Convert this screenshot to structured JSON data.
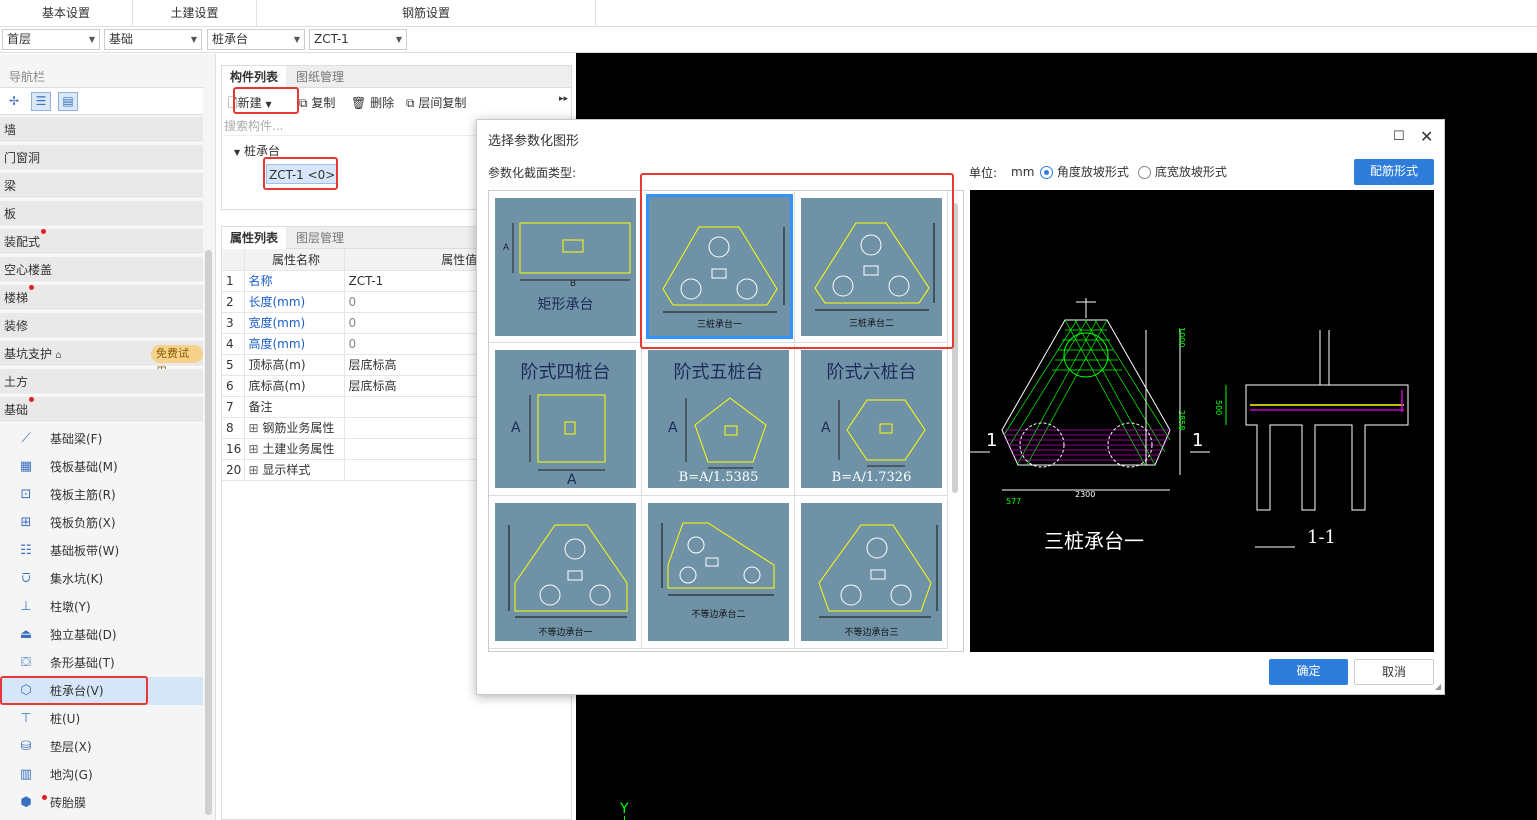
{
  "top_tabs": [
    "基本设置",
    "土建设置",
    "钢筋设置"
  ],
  "dropdowns": [
    "首层",
    "基础",
    "桩承台",
    "ZCT-1"
  ],
  "nav": {
    "title": "导航栏",
    "categories": [
      "墙",
      "门窗洞",
      "梁",
      "板",
      "装配式",
      "空心楼盖",
      "楼梯",
      "装修",
      "基坑支护",
      "土方",
      "基础"
    ],
    "badge": "免费试用",
    "items": [
      "基础梁(F)",
      "筏板基础(M)",
      "筏板主筋(R)",
      "筏板负筋(X)",
      "基础板带(W)",
      "集水坑(K)",
      "柱墩(Y)",
      "独立基础(D)",
      "条形基础(T)",
      "桩承台(V)",
      "桩(U)",
      "垫层(X)",
      "地沟(G)",
      "砖胎膜"
    ]
  },
  "component_panel": {
    "tabs": [
      "构件列表",
      "图纸管理"
    ],
    "toolbar": [
      "新建",
      "复制",
      "删除",
      "层间复制"
    ],
    "search_placeholder": "搜索构件...",
    "tree_parent": "桩承台",
    "tree_child": "ZCT-1 <0>"
  },
  "property_panel": {
    "tabs": [
      "属性列表",
      "图层管理"
    ],
    "headers": [
      "属性名称",
      "属性值"
    ],
    "rows": [
      {
        "num": "1",
        "name": "名称",
        "value": "ZCT-1",
        "blue": true
      },
      {
        "num": "2",
        "name": "长度(mm)",
        "value": "0",
        "blue": true
      },
      {
        "num": "3",
        "name": "宽度(mm)",
        "value": "0",
        "blue": true
      },
      {
        "num": "4",
        "name": "高度(mm)",
        "value": "0",
        "blue": true
      },
      {
        "num": "5",
        "name": "顶标高(m)",
        "value": "层底标高",
        "blue": false
      },
      {
        "num": "6",
        "name": "底标高(m)",
        "value": "层底标高",
        "blue": false
      },
      {
        "num": "7",
        "name": "备注",
        "value": "",
        "blue": false
      },
      {
        "num": "8",
        "name": "钢筋业务属性",
        "value": "",
        "blue": false,
        "expand": true
      },
      {
        "num": "16",
        "name": "土建业务属性",
        "value": "",
        "blue": false,
        "expand": true
      },
      {
        "num": "20",
        "name": "显示样式",
        "value": "",
        "blue": false,
        "expand": true
      }
    ]
  },
  "dialog": {
    "title": "选择参数化图形",
    "section_label": "参数化截面类型:",
    "unit_label": "单位:",
    "unit": "mm",
    "radio1": "角度放坡形式",
    "radio2": "底宽放坡形式",
    "config_button": "配筋形式",
    "ok": "确定",
    "cancel": "取消",
    "shapes": [
      "矩形承台",
      "三桩承台一",
      "三桩承台二",
      "阶式四桩台",
      "阶式五桩台",
      "阶式六桩台",
      "不等边承台一",
      "不等边承台二",
      "不等边承台三"
    ],
    "formula5": "B=A/1.5385",
    "formula6": "B=A/1.7326",
    "preview_title": "三桩承台一",
    "section_title": "1-1",
    "dim_2300": "2300",
    "dim_577": "577",
    "dim_1000": "1000",
    "dim_2858": "2858",
    "dim_500": "500"
  },
  "canvas_axis": "Y"
}
